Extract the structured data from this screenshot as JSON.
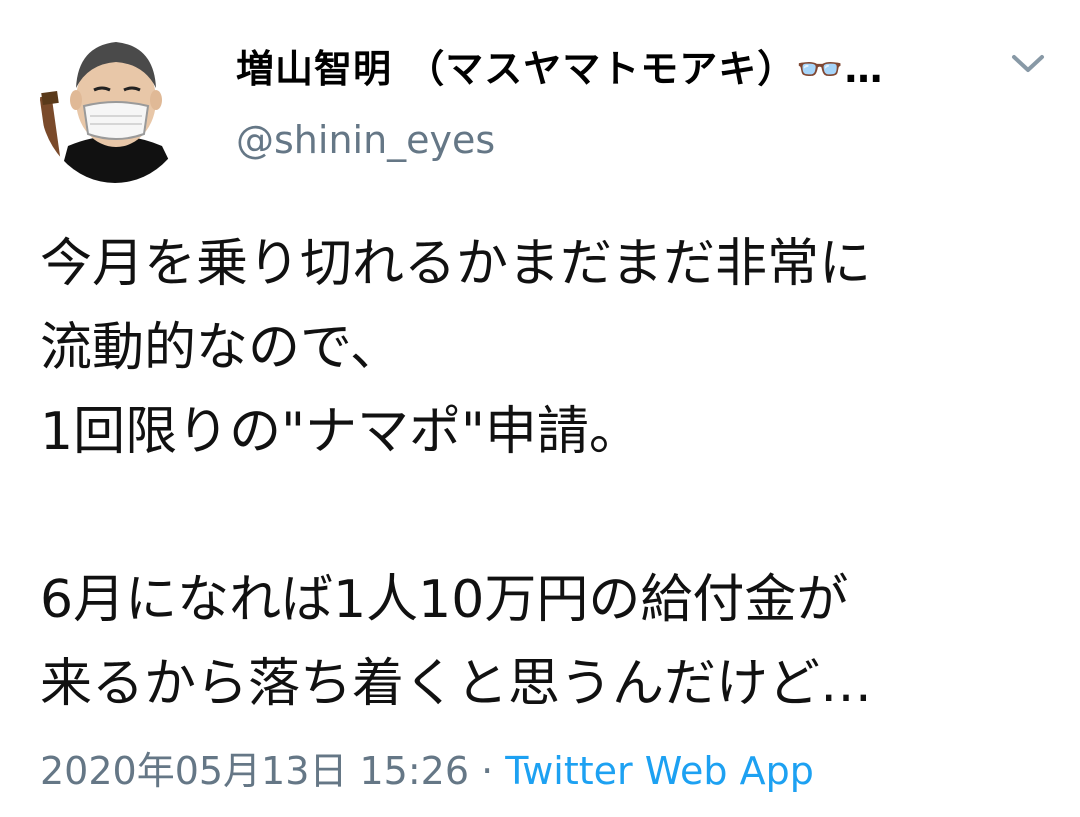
{
  "user": {
    "display_name": "増山智明 （マスヤマトモアキ）👓…",
    "handle": "@shinin_eyes"
  },
  "tweet": {
    "lines": [
      "今月を乗り切れるかまだまだ非常に",
      "流動的なので、",
      "1回限りの\"ナマポ\"申請。",
      "",
      "6月になれば1人10万円の給付金が",
      "来るから落ち着くと思うんだけど…"
    ],
    "timestamp": "2020年05月13日 15:26",
    "separator": " · ",
    "source": "Twitter Web App"
  },
  "icons": {
    "avatar": "user-avatar-masked-man",
    "menu": "chevron-down-icon"
  },
  "colors": {
    "text": "#14171a",
    "secondary": "#657786",
    "link": "#1da1f2"
  }
}
